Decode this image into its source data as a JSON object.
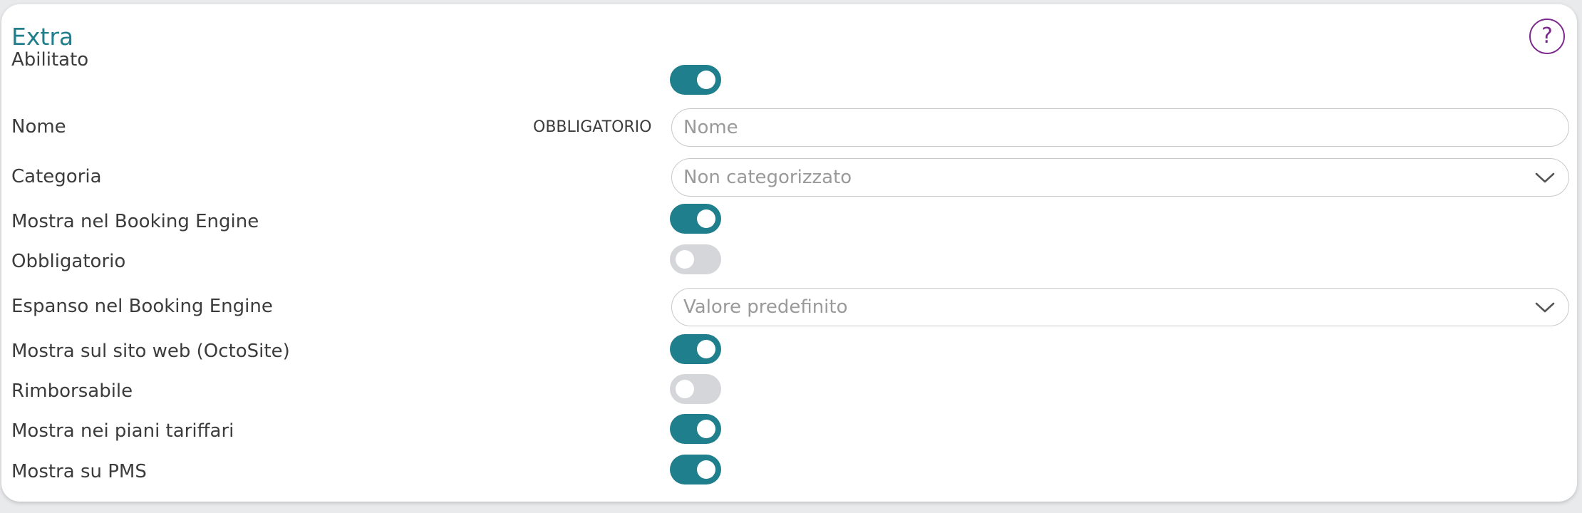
{
  "section": {
    "title": "Extra",
    "help_icon": "?"
  },
  "fields": {
    "abilitato": {
      "label": "Abilitato",
      "on": true
    },
    "nome": {
      "label": "Nome",
      "required_tag": "OBBLIGATORIO",
      "placeholder": "Nome",
      "value": ""
    },
    "categoria": {
      "label": "Categoria",
      "selected": "Non categorizzato"
    },
    "mostra_booking": {
      "label": "Mostra nel Booking Engine",
      "on": true
    },
    "obbligatorio": {
      "label": "Obbligatorio",
      "on": false
    },
    "espanso": {
      "label": "Espanso nel Booking Engine",
      "selected": "Valore predefinito"
    },
    "mostra_sito": {
      "label": "Mostra sul sito web (OctoSite)",
      "on": true
    },
    "rimborsabile": {
      "label": "Rimborsabile",
      "on": false
    },
    "mostra_piani": {
      "label": "Mostra nei piani tariffari",
      "on": true
    },
    "mostra_pms": {
      "label": "Mostra su PMS",
      "on": true
    }
  },
  "colors": {
    "accent": "#1f7f8c",
    "toggle_off": "#d4d6d9",
    "help": "#7b2a8c"
  },
  "icons": {
    "help": "question-circle-icon",
    "dropdown": "chevron-down-icon"
  }
}
